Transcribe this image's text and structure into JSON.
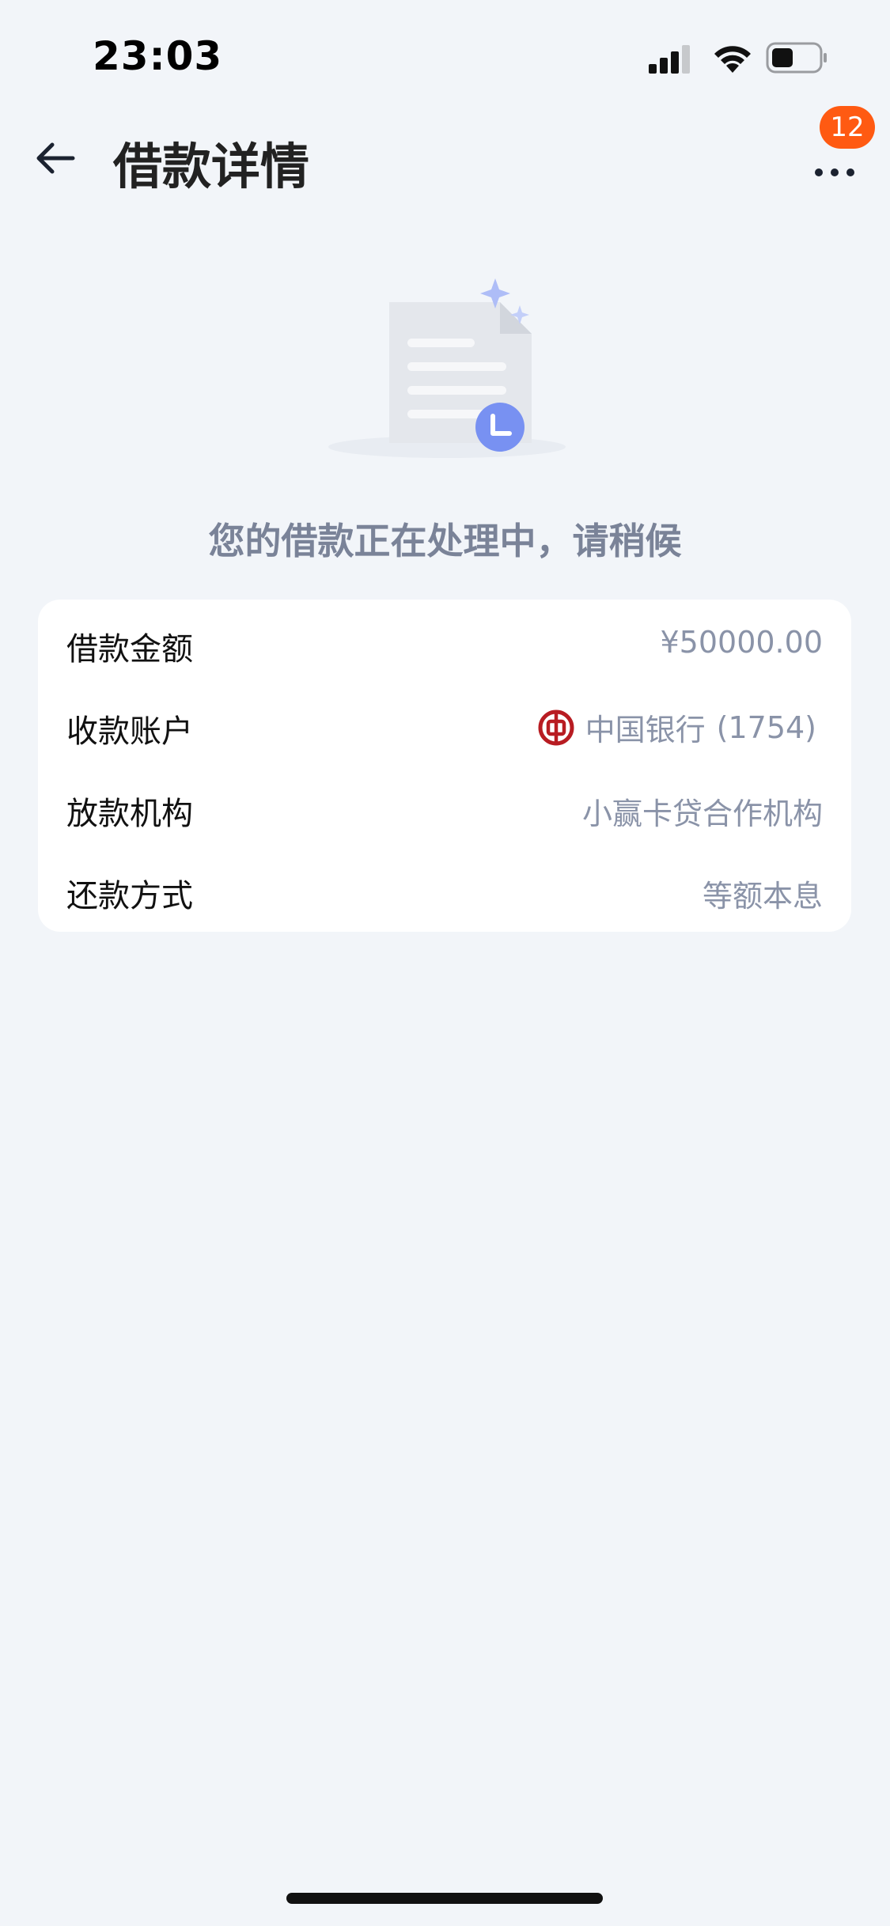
{
  "status_bar": {
    "time": "23:03"
  },
  "nav": {
    "title": "借款详情",
    "badge_count": "12"
  },
  "status_message": "您的借款正在处理中，请稍候",
  "details": [
    {
      "label": "借款金额",
      "value": "¥50000.00"
    },
    {
      "label": "收款账户",
      "bank_name": "中国银行",
      "account_suffix": "(1754)"
    },
    {
      "label": "放款机构",
      "value": "小赢卡贷合作机构"
    },
    {
      "label": "还款方式",
      "value": "等额本息"
    }
  ],
  "icons": {
    "back": "arrow-left-icon",
    "more": "more-dots-icon",
    "bank": "bank-of-china-logo",
    "illustration": "document-pending-illustration"
  },
  "colors": {
    "background": "#f2f5f9",
    "badge": "#ff5a12",
    "value_text": "#8a93a8",
    "clock_accent": "#7891f2",
    "bank_red": "#b81c22"
  }
}
